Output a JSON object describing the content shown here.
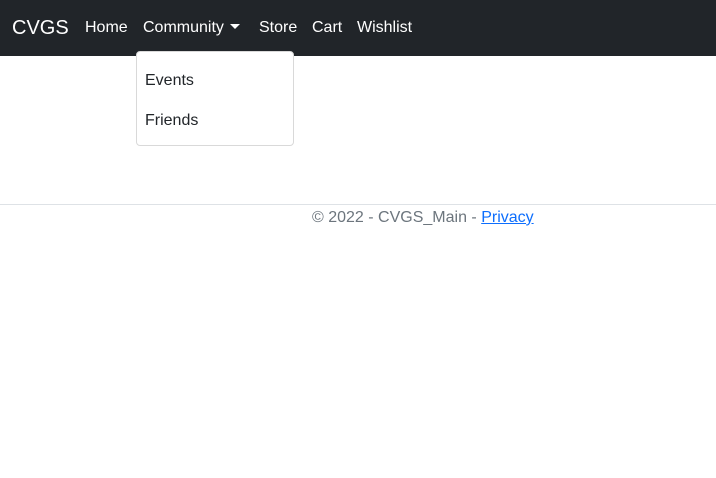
{
  "navbar": {
    "brand": "CVGS",
    "links": {
      "home": "Home",
      "community": "Community",
      "store": "Store",
      "cart": "Cart",
      "wishlist": "Wishlist"
    },
    "community_dropdown": {
      "items": [
        "Events",
        "Friends"
      ]
    }
  },
  "footer": {
    "copyright": "© 2022 - CVGS_Main - ",
    "privacy_link": "Privacy"
  },
  "colors": {
    "navbar_bg": "#212529",
    "link": "#0d6efd",
    "footer_text": "#6c757d"
  },
  "icons": {
    "dropdown_caret": "caret-down-icon"
  }
}
